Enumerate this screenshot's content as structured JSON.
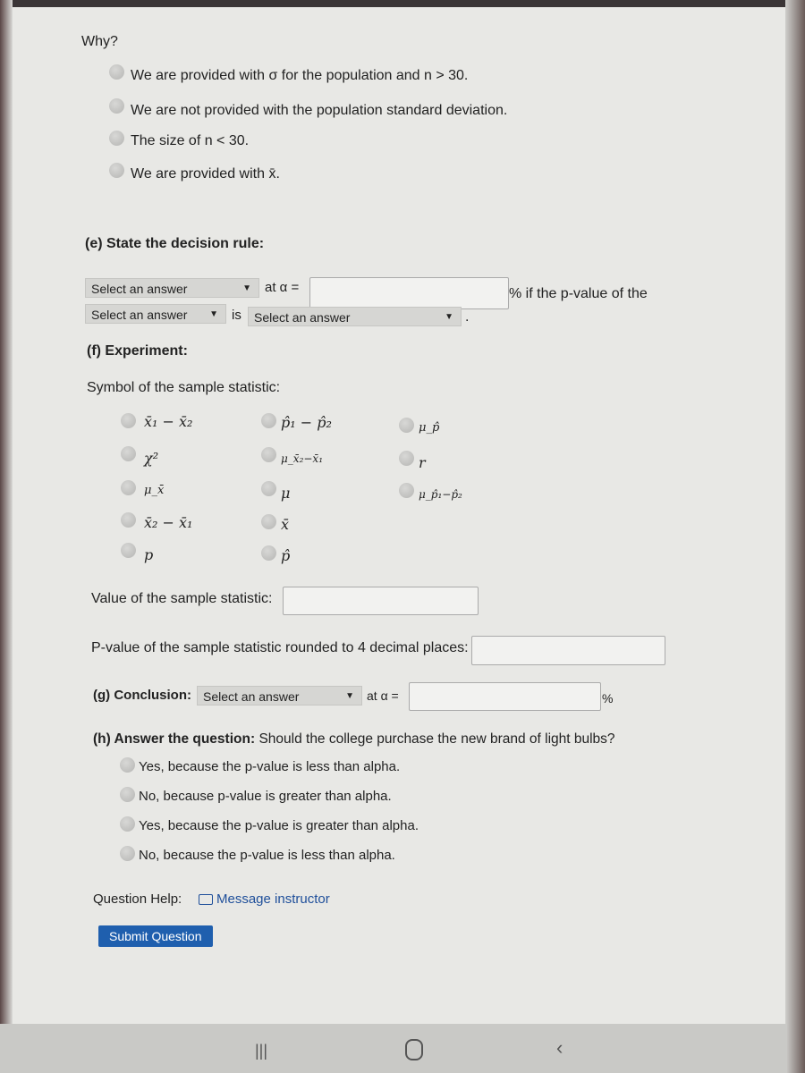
{
  "why": {
    "label": "Why?",
    "options": [
      "We are provided with σ for the population and n > 30.",
      "We are not provided with the population standard deviation.",
      "The size of n < 30.",
      "We are provided with x̄."
    ]
  },
  "decision_rule": {
    "heading": "(e) State the decision rule:",
    "select1": "Select an answer",
    "at_alpha": "at α =",
    "pvalue_text": "% if the p-value of the",
    "select2": "Select an answer",
    "is": "is",
    "select3": "Select an answer",
    "period": "."
  },
  "experiment": {
    "heading": "(f) Experiment:",
    "symbol_label": "Symbol of the sample statistic:",
    "symbols": {
      "col1": [
        "x̄₁ − x̄₂",
        "χ²",
        "μ_x̄",
        "x̄₂ − x̄₁",
        "p"
      ],
      "col2": [
        "p̂₁ − p̂₂",
        "μ_x̄₂−x̄₁",
        "μ",
        "x̄",
        "p̂"
      ],
      "col3": [
        "μ_p̂",
        "r",
        "μ_p̂₁−p̂₂"
      ]
    },
    "value_label": "Value of the sample statistic:",
    "pvalue_label": "P-value of the sample statistic rounded to 4 decimal places:"
  },
  "conclusion": {
    "heading": "(g) Conclusion:",
    "select": "Select an answer",
    "at_alpha": "at α =",
    "percent": "%"
  },
  "question": {
    "heading": "(h) Answer the question:",
    "text": "Should the college purchase the new brand of light bulbs?",
    "options": [
      "Yes, because the p-value is less than alpha.",
      "No, because p-value is greater than alpha.",
      "Yes, because the p-value is greater than alpha.",
      "No, because the p-value is less than alpha."
    ]
  },
  "help": {
    "label": "Question Help:",
    "message": "Message instructor"
  },
  "submit": "Submit Question",
  "colors": {
    "accent": "#1f5fae",
    "background": "#e8e8e5"
  }
}
